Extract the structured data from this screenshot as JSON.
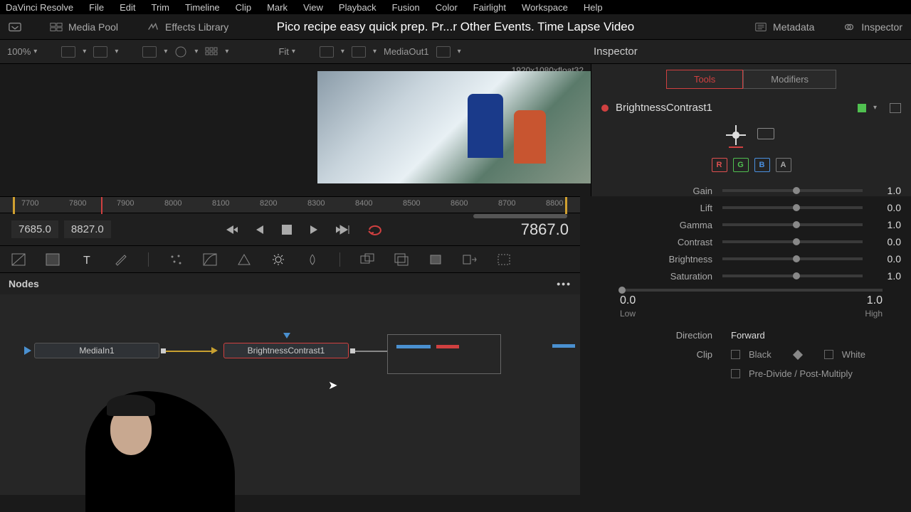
{
  "menu": [
    "DaVinci Resolve",
    "File",
    "Edit",
    "Trim",
    "Timeline",
    "Clip",
    "Mark",
    "View",
    "Playback",
    "Fusion",
    "Color",
    "Fairlight",
    "Workspace",
    "Help"
  ],
  "topbar": {
    "media_pool": "Media Pool",
    "effects": "Effects Library",
    "metadata": "Metadata",
    "inspector": "Inspector",
    "title_overlay": "Pico recipe easy quick prep. Pr...r Other Events. Time Lapse Video"
  },
  "controls": {
    "zoom": "100%",
    "fit": "Fit",
    "media_out": "MediaOut1",
    "inspector_title": "Inspector",
    "resolution": "1920x1080xfloat32"
  },
  "ruler": {
    "ticks": [
      "7700",
      "7800",
      "7900",
      "8000",
      "8100",
      "8200",
      "8300",
      "8400",
      "8500",
      "8600",
      "8700",
      "8800"
    ],
    "playhead_frame": 7867
  },
  "transport": {
    "in": "7685.0",
    "out": "8827.0",
    "current": "7867.0"
  },
  "nodes_panel": {
    "title": "Nodes",
    "node1": "MediaIn1",
    "node2": "BrightnessContrast1"
  },
  "inspector": {
    "tabs": {
      "tools": "Tools",
      "modifiers": "Modifiers"
    },
    "node_name": "BrightnessContrast1",
    "channels": {
      "r": "R",
      "g": "G",
      "b": "B",
      "a": "A"
    },
    "params": [
      {
        "label": "Gain",
        "value": "1.0",
        "pos": 0.5
      },
      {
        "label": "Lift",
        "value": "0.0",
        "pos": 0.5
      },
      {
        "label": "Gamma",
        "value": "1.0",
        "pos": 0.5
      },
      {
        "label": "Contrast",
        "value": "0.0",
        "pos": 0.5
      },
      {
        "label": "Brightness",
        "value": "0.0",
        "pos": 0.5
      },
      {
        "label": "Saturation",
        "value": "1.0",
        "pos": 0.5
      }
    ],
    "range": {
      "low_val": "0.0",
      "high_val": "1.0",
      "low_label": "Low",
      "high_label": "High"
    },
    "direction": {
      "label": "Direction",
      "value": "Forward"
    },
    "clip": {
      "label": "Clip",
      "black": "Black",
      "white": "White"
    },
    "predivide": "Pre-Divide / Post-Multiply"
  }
}
